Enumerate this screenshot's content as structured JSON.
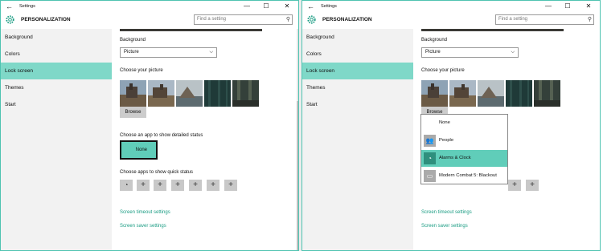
{
  "window": {
    "title": "Settings",
    "back_glyph": "←",
    "controls": {
      "minimize": "—",
      "maximize": "☐",
      "close": "✕"
    }
  },
  "header": {
    "title": "PERSONALIZATION",
    "search_placeholder": "Find a setting",
    "icon": "gear-icon"
  },
  "sidebar": {
    "items": [
      {
        "label": "Background"
      },
      {
        "label": "Colors"
      },
      {
        "label": "Lock screen",
        "selected": true
      },
      {
        "label": "Themes"
      },
      {
        "label": "Start"
      }
    ]
  },
  "content": {
    "background_label": "Background",
    "background_value": "Picture",
    "choose_picture_label": "Choose your picture",
    "browse_label": "Browse",
    "detailed_status_label": "Choose an app to show detailed status",
    "detailed_status_value": "None",
    "quick_status_label": "Choose apps to show quick status",
    "quick_slots": [
      "alarm-icon",
      "+",
      "+",
      "+",
      "+",
      "+",
      "+"
    ],
    "links": {
      "timeout": "Screen timeout settings",
      "saver": "Screen saver settings"
    }
  },
  "popup": {
    "items": [
      {
        "label": "None",
        "icon": ""
      },
      {
        "label": "People",
        "icon": "people-icon"
      },
      {
        "label": "Alarms & Clock",
        "icon": "alarm-clock-icon",
        "selected": true
      },
      {
        "label": "Modern Combat 5: Blackout",
        "icon": "game-icon"
      }
    ]
  },
  "colors": {
    "accent": "#60cdb9",
    "sidebar_selected": "#7fd8c8",
    "link": "#1a9c83"
  }
}
